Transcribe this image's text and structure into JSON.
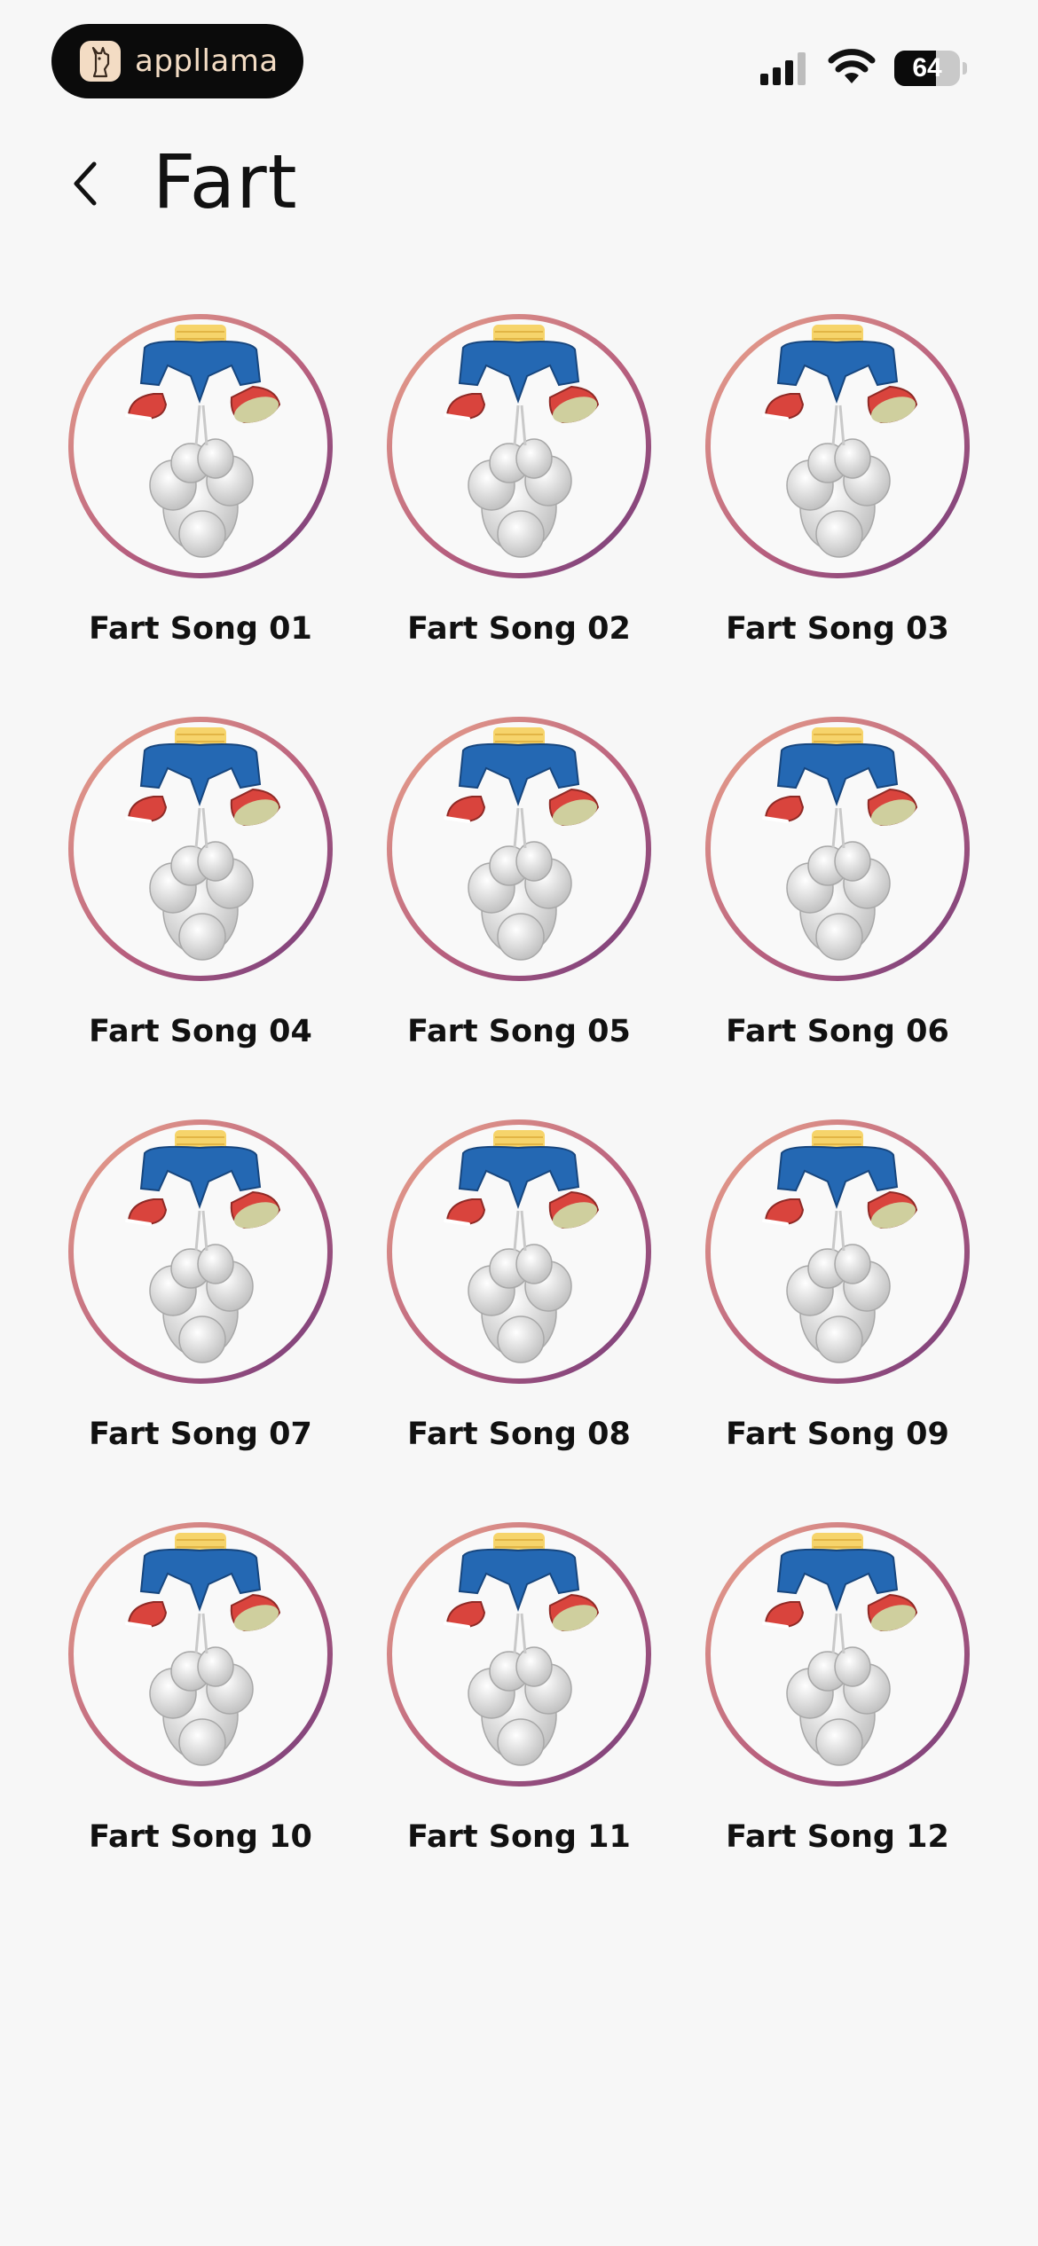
{
  "status_bar": {
    "brand_name": "appllama",
    "brand_icon": "llama-icon",
    "battery_level": 64,
    "battery_text": "64",
    "signal_bars": 3,
    "brand_color": "#f3dcc4"
  },
  "header": {
    "back_icon": "chevron-left-icon",
    "title": "Fart"
  },
  "theme": {
    "ring_gradient_start": "#e8a08a",
    "ring_gradient_end": "#7e3f7a",
    "background": "#f7f7f7"
  },
  "songs": [
    {
      "label": "Fart Song 01"
    },
    {
      "label": "Fart Song 02"
    },
    {
      "label": "Fart Song 03"
    },
    {
      "label": "Fart Song 04"
    },
    {
      "label": "Fart Song 05"
    },
    {
      "label": "Fart Song 06"
    },
    {
      "label": "Fart Song 07"
    },
    {
      "label": "Fart Song 08"
    },
    {
      "label": "Fart Song 09"
    },
    {
      "label": "Fart Song 10"
    },
    {
      "label": "Fart Song 11"
    },
    {
      "label": "Fart Song 12"
    }
  ]
}
